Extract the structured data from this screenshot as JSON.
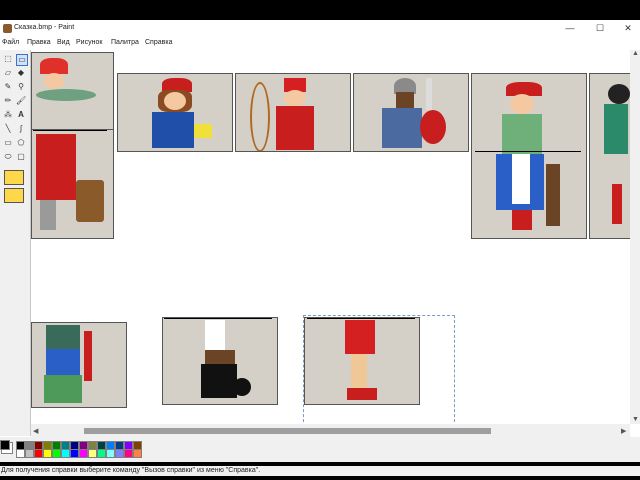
{
  "window": {
    "title": "Сказка.bmp - Paint",
    "icon": "paint-icon"
  },
  "controls": {
    "minimize": "—",
    "maximize": "☐",
    "close": "✕"
  },
  "menu": [
    "Файл",
    "Правка",
    "Вид",
    "Рисунок",
    "Палитра",
    "Справка"
  ],
  "status": "Для получения справки выберите команду \"Вызов справки\" из меню \"Справка\".",
  "palette": {
    "foreground": "#000000",
    "background": "#ffffff",
    "colors": [
      "#000000",
      "#808080",
      "#800000",
      "#808000",
      "#008000",
      "#008080",
      "#000080",
      "#800080",
      "#808040",
      "#004040",
      "#0080ff",
      "#004080",
      "#8000ff",
      "#804000",
      "#ffffff",
      "#c0c0c0",
      "#ff0000",
      "#ffff00",
      "#00ff00",
      "#00ffff",
      "#0000ff",
      "#ff00ff",
      "#ffff80",
      "#00ff80",
      "#80ffff",
      "#8080ff",
      "#ff0080",
      "#ff8040"
    ]
  },
  "scroll": {
    "horizontal_position": 0.07,
    "horizontal_visible": 0.71
  }
}
